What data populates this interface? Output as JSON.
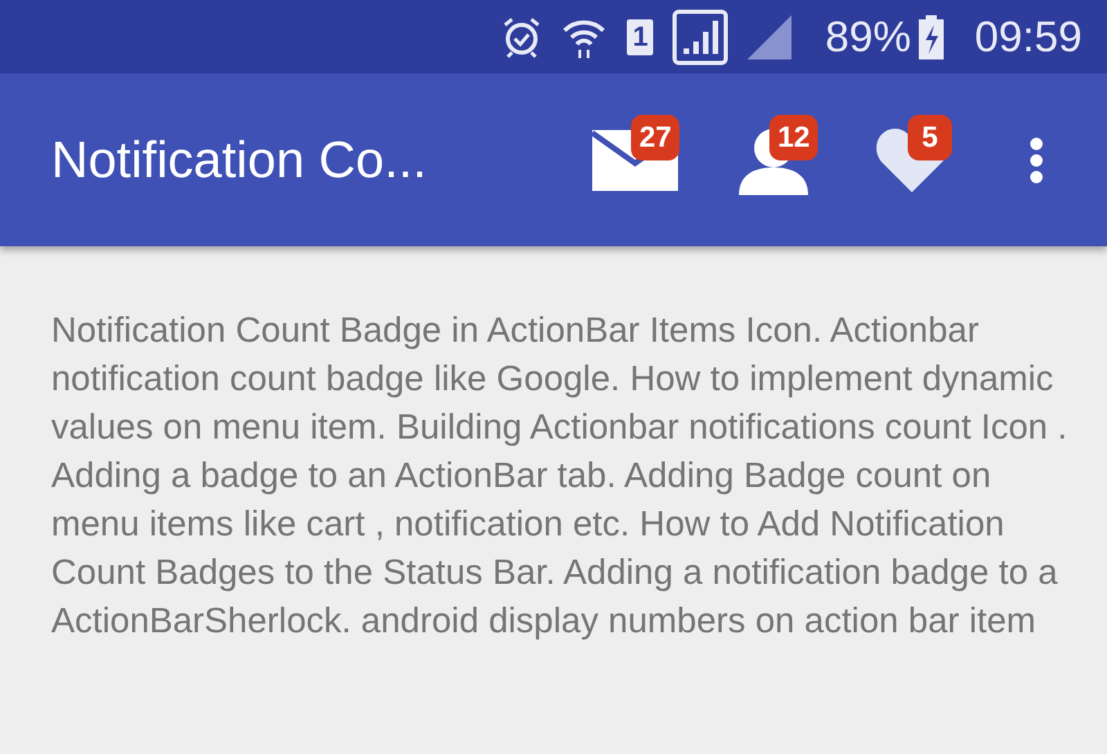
{
  "status_bar": {
    "sim": "1",
    "battery": "89%",
    "time": "09:59"
  },
  "app_bar": {
    "title": "Notification Co...",
    "actions": [
      {
        "kind": "mail",
        "badge": "27"
      },
      {
        "kind": "person",
        "badge": "12"
      },
      {
        "kind": "heart",
        "badge": "5"
      }
    ]
  },
  "content": {
    "text": "Notification Count Badge in ActionBar Items Icon. Actionbar notification count badge like Google. How to implement dynamic values on menu item. Building Actionbar notifications count Icon . Adding a badge to an ActionBar tab. Adding Badge count on menu items like cart , notification etc. How to Add Notification Count Badges to the Status Bar. Adding a notification badge to a ActionBarSherlock. android display numbers on action bar item"
  }
}
